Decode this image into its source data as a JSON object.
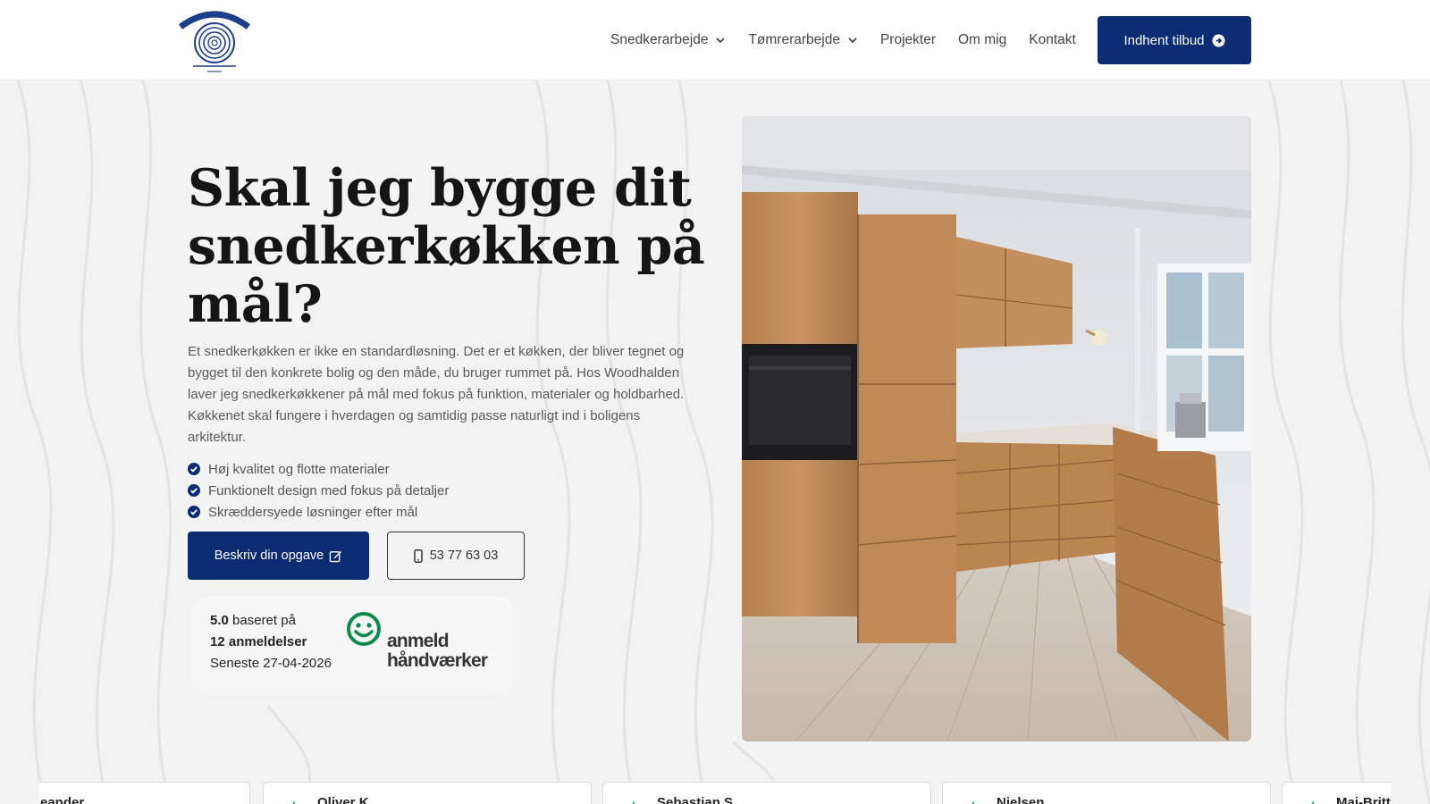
{
  "header": {
    "logo_alt": "Woodhalden",
    "nav": [
      {
        "label": "Snedkerarbejde",
        "has_dropdown": true
      },
      {
        "label": "Tømrerarbejde",
        "has_dropdown": true
      },
      {
        "label": "Projekter",
        "has_dropdown": false
      },
      {
        "label": "Om mig",
        "has_dropdown": false
      },
      {
        "label": "Kontakt",
        "has_dropdown": false
      }
    ],
    "cta_label": "Indhent tilbud",
    "cta_icon": "arrow-circle-right-icon"
  },
  "hero": {
    "title": "Skal jeg bygge dit snedkerkøkken på mål?",
    "text": "Et snedkerkøkken er ikke en standardløsning. Det er et køkken, der bliver tegnet og bygget til den konkrete bolig og den måde, du bruger rummet på. Hos Woodhalden laver jeg snedkerkøkkener på mål med fokus på funktion, materialer og holdbarhed. Køkkenet skal fungere i hverdagen og samtidig passe naturligt ind i boligens arkitektur.",
    "checklist": [
      "Høj kvalitet og flotte materialer",
      "Funktionelt design med fokus på detaljer",
      "Skræddersyede løsninger efter mål"
    ],
    "primary_button": "Beskriv din opgave",
    "phone_button": "53 77 63 03"
  },
  "rating": {
    "score": "5.0",
    "based_on": "baseret på",
    "count": "12 anmeldelser",
    "latest": "Seneste 27-04-2026",
    "brand_line1": "anmeld",
    "brand_line2": "håndværker"
  },
  "reviews": [
    {
      "name": "eander"
    },
    {
      "name": "Oliver K"
    },
    {
      "name": "Sebastian S"
    },
    {
      "name": "Nielsen"
    },
    {
      "name": "Mai-Britt"
    }
  ],
  "colors": {
    "brand_blue": "#0b2b73",
    "anmeld_green": "#0b8a4a",
    "background": "#f3f3f3"
  }
}
